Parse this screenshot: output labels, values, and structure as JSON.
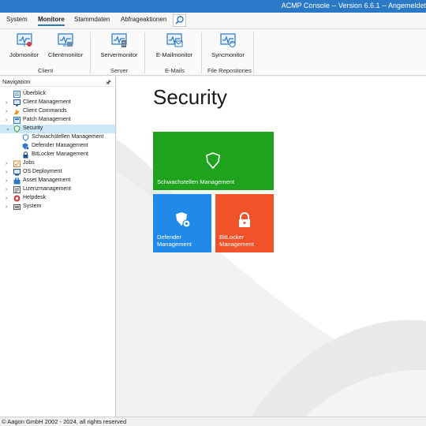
{
  "window": {
    "title": "ACMP Console -- Version 6.6.1 -- Angemeldet"
  },
  "ribbon_tabs": [
    "System",
    "Monitore",
    "Stammdaten",
    "Abfrageaktionen"
  ],
  "ribbon_groups": {
    "client": {
      "label": "Client",
      "buttons": [
        {
          "label": "Jobmonitor",
          "icon": "job-monitor-icon"
        },
        {
          "label": "Clientmonitor",
          "icon": "client-monitor-icon"
        }
      ]
    },
    "server": {
      "label": "Server",
      "buttons": [
        {
          "label": "Servermonitor",
          "icon": "server-monitor-icon"
        }
      ]
    },
    "emails": {
      "label": "E-Mails",
      "buttons": [
        {
          "label": "E-Mailmonitor",
          "icon": "email-monitor-icon"
        }
      ]
    },
    "file_repositories": {
      "label": "File Repositories",
      "buttons": [
        {
          "label": "Syncmonitor",
          "icon": "sync-monitor-icon"
        }
      ]
    }
  },
  "navigation": {
    "header": "Navigation",
    "items": [
      {
        "label": "Überblick",
        "icon": "overview-icon"
      },
      {
        "label": "Client Management",
        "icon": "client-management-icon"
      },
      {
        "label": "Client Commands",
        "icon": "client-commands-icon"
      },
      {
        "label": "Patch Management",
        "icon": "patch-management-icon"
      },
      {
        "label": "Security",
        "icon": "security-shield-icon",
        "expanded": true,
        "selected": true
      },
      {
        "label": "Schwachstellen Management",
        "icon": "shield-outline-icon"
      },
      {
        "label": "Defender Management",
        "icon": "defender-icon"
      },
      {
        "label": "BitLocker Management",
        "icon": "lock-icon"
      },
      {
        "label": "Jobs",
        "icon": "jobs-icon"
      },
      {
        "label": "OS Deployment",
        "icon": "os-deployment-icon"
      },
      {
        "label": "Asset Management",
        "icon": "asset-management-icon"
      },
      {
        "label": "Lizenzmanagement",
        "icon": "license-icon"
      },
      {
        "label": "Helpdesk",
        "icon": "helpdesk-icon"
      },
      {
        "label": "System",
        "icon": "system-icon"
      }
    ]
  },
  "main": {
    "title": "Security",
    "tiles": [
      {
        "label": "Schwachstellen Management",
        "color": "#1fa31f",
        "icon": "shield-outline-icon"
      },
      {
        "label_line1": "Defender",
        "label_line2": "Management",
        "color": "#2189e8",
        "icon": "defender-gear-icon"
      },
      {
        "label_line1": "BitLocker",
        "label_line2": "Management",
        "color": "#f0522a",
        "icon": "lock-icon"
      }
    ]
  },
  "status": {
    "text": "© Aagon GmbH 2002 - 2024, all rights reserved"
  },
  "colors": {
    "accent": "#2b78c6",
    "selected_row": "#cde6f7"
  }
}
